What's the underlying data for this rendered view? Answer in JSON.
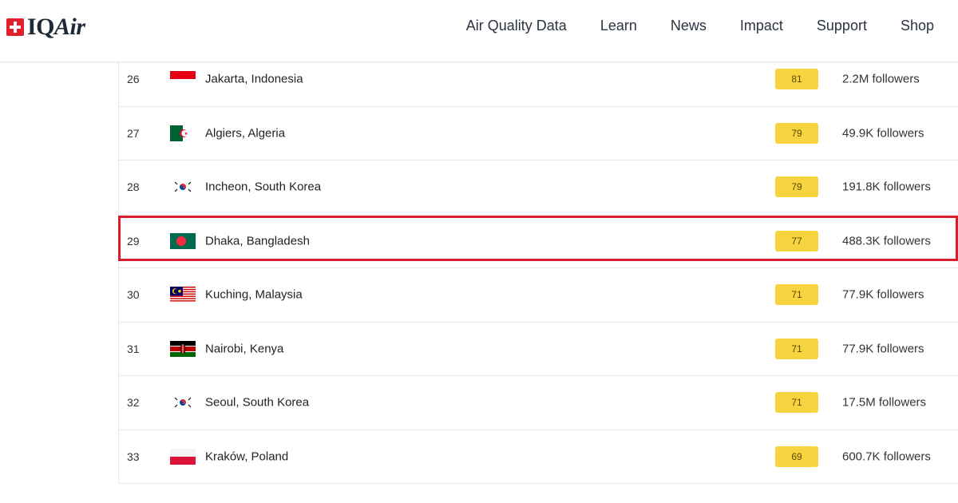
{
  "header": {
    "logo_text_iq": "IQ",
    "logo_text_air": "Air",
    "nav": [
      "Air Quality Data",
      "Learn",
      "News",
      "Impact",
      "Support",
      "Shop"
    ]
  },
  "colors": {
    "aqi_moderate": "#f7d33f",
    "highlight": "#d81e2c"
  },
  "rows": [
    {
      "rank": "26",
      "city": "Jakarta, Indonesia",
      "flag": "indonesia-flag",
      "aqi": "81",
      "followers": "2.2M followers"
    },
    {
      "rank": "27",
      "city": "Algiers, Algeria",
      "flag": "algeria-flag",
      "aqi": "79",
      "followers": "49.9K followers"
    },
    {
      "rank": "28",
      "city": "Incheon, South Korea",
      "flag": "south-korea-flag",
      "aqi": "79",
      "followers": "191.8K followers"
    },
    {
      "rank": "29",
      "city": "Dhaka, Bangladesh",
      "flag": "bangladesh-flag",
      "aqi": "77",
      "followers": "488.3K followers",
      "highlighted": true
    },
    {
      "rank": "30",
      "city": "Kuching, Malaysia",
      "flag": "malaysia-flag",
      "aqi": "71",
      "followers": "77.9K followers"
    },
    {
      "rank": "31",
      "city": "Nairobi, Kenya",
      "flag": "kenya-flag",
      "aqi": "71",
      "followers": "77.9K followers"
    },
    {
      "rank": "32",
      "city": "Seoul, South Korea",
      "flag": "south-korea-flag",
      "aqi": "71",
      "followers": "17.5M followers"
    },
    {
      "rank": "33",
      "city": "Kraków, Poland",
      "flag": "poland-flag",
      "aqi": "69",
      "followers": "600.7K followers"
    }
  ]
}
